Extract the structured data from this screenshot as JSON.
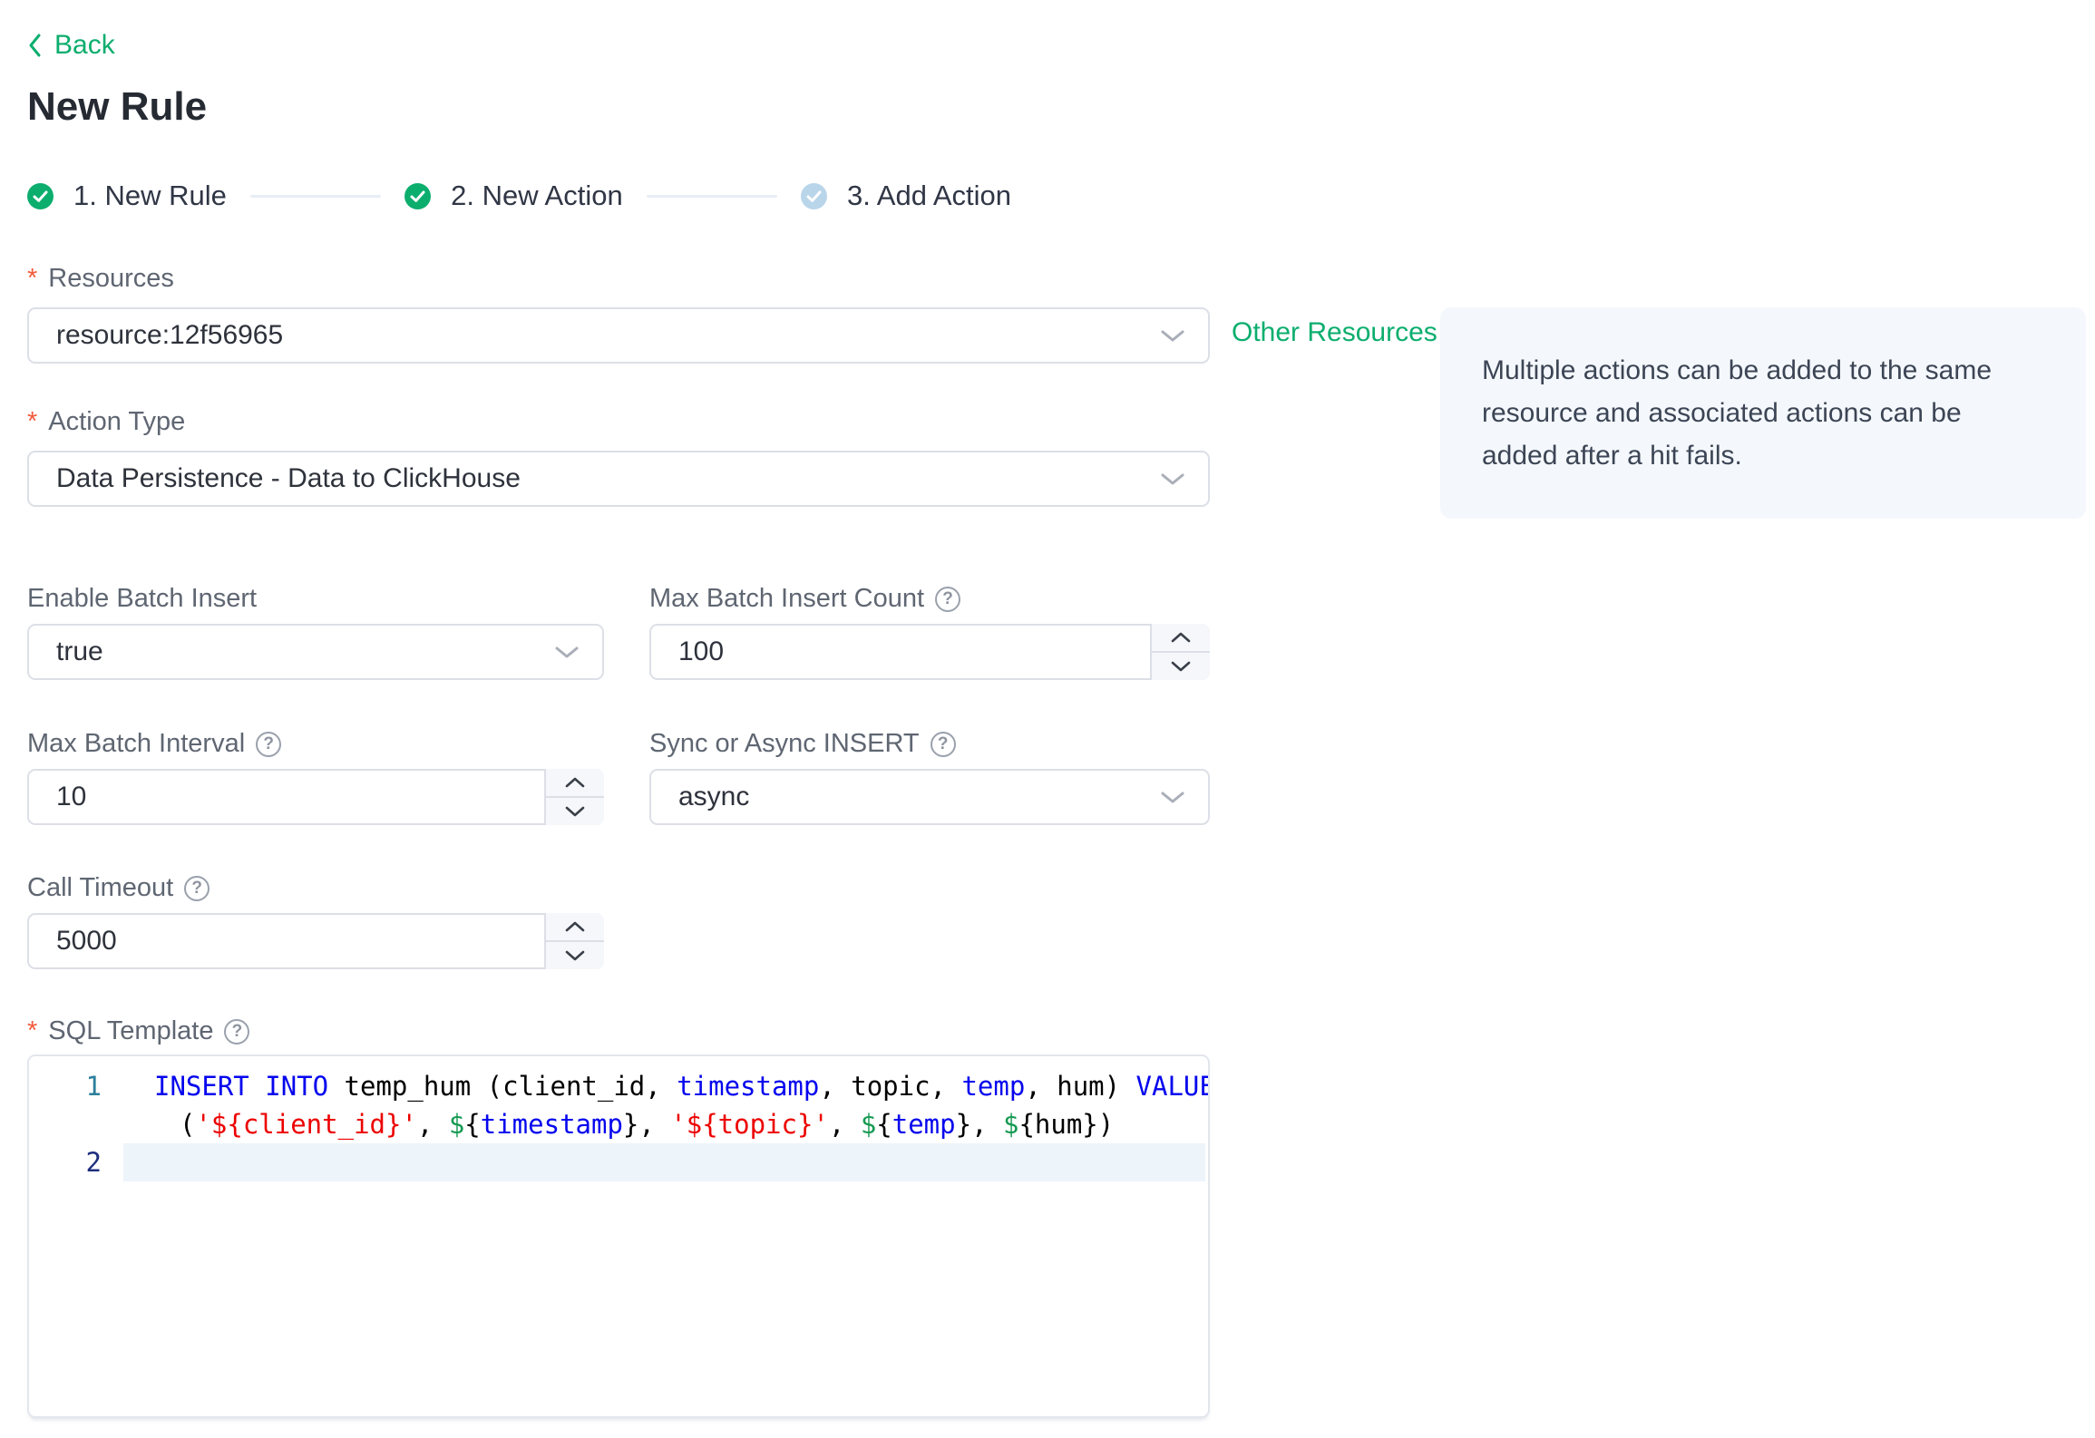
{
  "ui": {
    "required_marker": "*",
    "help_glyph": "?"
  },
  "page": {
    "back_label": "Back",
    "title": "New Rule"
  },
  "stepper": {
    "steps": [
      {
        "label": "1. New Rule",
        "state": "done"
      },
      {
        "label": "2. New Action",
        "state": "done"
      },
      {
        "label": "3. Add Action",
        "state": "pending"
      }
    ]
  },
  "form": {
    "resources": {
      "label": "Resources",
      "value": "resource:12f56965",
      "other_resources_link": "Other Resources"
    },
    "action_type": {
      "label": "Action Type",
      "value": "Data Persistence - Data to ClickHouse"
    },
    "enable_batch_insert": {
      "label": "Enable Batch Insert",
      "value": "true"
    },
    "max_batch_insert_count": {
      "label": "Max Batch Insert Count",
      "value": "100"
    },
    "max_batch_interval": {
      "label": "Max Batch Interval",
      "value": "10"
    },
    "sync_or_async_insert": {
      "label": "Sync or Async INSERT",
      "value": "async"
    },
    "call_timeout": {
      "label": "Call Timeout",
      "value": "5000"
    },
    "sql_template": {
      "label": "SQL Template"
    }
  },
  "info_box": {
    "text": "Multiple actions can be added to the same resource and associated actions can be added after a hit fails."
  },
  "editor": {
    "lines": [
      {
        "number": "1",
        "number_color": "#2a7f9b",
        "active": false,
        "rows": [
          [
            {
              "t": "INSERT",
              "c": "kw"
            },
            {
              "t": " ",
              "c": "pl"
            },
            {
              "t": "INTO",
              "c": "kw"
            },
            {
              "t": " temp_hum (client_id, ",
              "c": "pl"
            },
            {
              "t": "timestamp",
              "c": "kw"
            },
            {
              "t": ", topic, ",
              "c": "pl"
            },
            {
              "t": "temp",
              "c": "kw"
            },
            {
              "t": ", hum) ",
              "c": "pl"
            },
            {
              "t": "VALUES",
              "c": "kw"
            }
          ],
          [
            {
              "t": "(",
              "c": "pl"
            },
            {
              "t": "'${client_id}'",
              "c": "str"
            },
            {
              "t": ", ",
              "c": "pl"
            },
            {
              "t": "$",
              "c": "dl"
            },
            {
              "t": "{",
              "c": "pl"
            },
            {
              "t": "timestamp",
              "c": "kw"
            },
            {
              "t": "}, ",
              "c": "pl"
            },
            {
              "t": "'${topic}'",
              "c": "str"
            },
            {
              "t": ", ",
              "c": "pl"
            },
            {
              "t": "$",
              "c": "dl"
            },
            {
              "t": "{",
              "c": "pl"
            },
            {
              "t": "temp",
              "c": "kw"
            },
            {
              "t": "}, ",
              "c": "pl"
            },
            {
              "t": "$",
              "c": "dl"
            },
            {
              "t": "{hum})",
              "c": "pl"
            }
          ]
        ]
      },
      {
        "number": "2",
        "number_color": "#1e2f7d",
        "active": true,
        "rows": [
          []
        ]
      }
    ]
  },
  "colors": {
    "brand_green": "#0cae6e",
    "pending_step_blue": "#b9d5ea",
    "required_red": "#f25b3a",
    "keyword_blue": "#0505ee",
    "string_red": "#ec0000",
    "dollar_green": "#159a52",
    "active_line_bg": "#edf4fa",
    "info_box_bg": "#f4f8fc"
  }
}
